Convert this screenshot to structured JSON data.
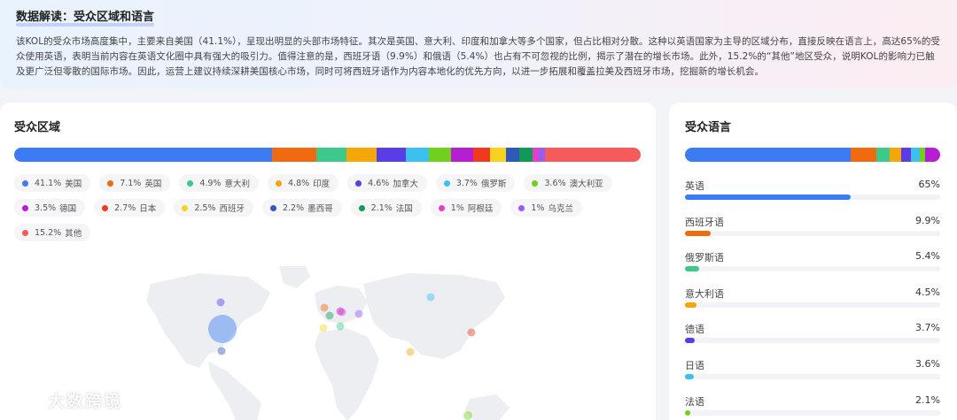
{
  "insight": {
    "title": "数据解读：受众区域和语言",
    "text": "该KOL的受众市场高度集中，主要来自美国（41.1%），呈现出明显的头部市场特征。其次是英国、意大利、印度和加拿大等多个国家，但占比相对分散。这种以英语国家为主导的区域分布，直接反映在语言上，高达65%的受众使用英语，表明当前内容在英语文化圈中具有强大的吸引力。值得注意的是，西班牙语（9.9%）和俄语（5.4%）也占有不可忽视的比例，揭示了潜在的增长市场。此外，15.2%的“其他”地区受众，说明KOL的影响力已触及更广泛但零散的国际市场。因此，运营上建议持续深耕美国核心市场，同时可将西班牙语作为内容本地化的优先方向，以进一步拓展和覆盖拉美及西班牙市场，挖掘新的增长机会。"
  },
  "region": {
    "title": "受众区域",
    "items": [
      {
        "value": "41.1%",
        "pct": 41.1,
        "name": "美国",
        "color": "#3b7cf4"
      },
      {
        "value": "7.1%",
        "pct": 7.1,
        "name": "英国",
        "color": "#f06a0f"
      },
      {
        "value": "4.9%",
        "pct": 4.9,
        "name": "意大利",
        "color": "#3cc98a"
      },
      {
        "value": "4.8%",
        "pct": 4.8,
        "name": "印度",
        "color": "#f5a70a"
      },
      {
        "value": "4.6%",
        "pct": 4.6,
        "name": "加拿大",
        "color": "#5b3de8"
      },
      {
        "value": "3.7%",
        "pct": 3.7,
        "name": "俄罗斯",
        "color": "#3dbff0"
      },
      {
        "value": "3.6%",
        "pct": 3.6,
        "name": "澳大利亚",
        "color": "#6fd11c"
      },
      {
        "value": "3.5%",
        "pct": 3.5,
        "name": "德国",
        "color": "#b51fd1"
      },
      {
        "value": "2.7%",
        "pct": 2.7,
        "name": "日本",
        "color": "#f0391e"
      },
      {
        "value": "2.5%",
        "pct": 2.5,
        "name": "西班牙",
        "color": "#f7d21e"
      },
      {
        "value": "2.2%",
        "pct": 2.2,
        "name": "墨西哥",
        "color": "#2d59b8"
      },
      {
        "value": "2.1%",
        "pct": 2.1,
        "name": "法国",
        "color": "#119a56"
      },
      {
        "value": "1%",
        "pct": 1.0,
        "name": "阿根廷",
        "color": "#e53ec9"
      },
      {
        "value": "1%",
        "pct": 1.0,
        "name": "乌克兰",
        "color": "#9a5cf0"
      },
      {
        "value": "15.2%",
        "pct": 15.2,
        "name": "其他",
        "color": "#f65a5a"
      }
    ]
  },
  "language": {
    "title": "受众语言",
    "items": [
      {
        "name": "英语",
        "value": "65%",
        "pct": 65,
        "color": "#3b7cf4"
      },
      {
        "name": "西班牙语",
        "value": "9.9%",
        "pct": 9.9,
        "color": "#f06a0f"
      },
      {
        "name": "俄罗斯语",
        "value": "5.4%",
        "pct": 5.4,
        "color": "#3cc98a"
      },
      {
        "name": "意大利语",
        "value": "4.5%",
        "pct": 4.5,
        "color": "#f5a70a"
      },
      {
        "name": "德语",
        "value": "3.7%",
        "pct": 3.7,
        "color": "#5b3de8"
      },
      {
        "name": "日语",
        "value": "3.6%",
        "pct": 3.6,
        "color": "#3dbff0"
      },
      {
        "name": "法语",
        "value": "2.1%",
        "pct": 2.1,
        "color": "#6fd11c"
      }
    ],
    "bar_segments": [
      {
        "pct": 65,
        "color": "#3b7cf4"
      },
      {
        "pct": 9.9,
        "color": "#f06a0f"
      },
      {
        "pct": 5.4,
        "color": "#3cc98a"
      },
      {
        "pct": 4.5,
        "color": "#f5a70a"
      },
      {
        "pct": 3.7,
        "color": "#5b3de8"
      },
      {
        "pct": 3.6,
        "color": "#3dbff0"
      },
      {
        "pct": 2.1,
        "color": "#6fd11c"
      },
      {
        "pct": 5.8,
        "color": "#b51fd1"
      }
    ]
  },
  "watermark": {
    "text": "大数跨境",
    "icon": "logo-icon"
  }
}
